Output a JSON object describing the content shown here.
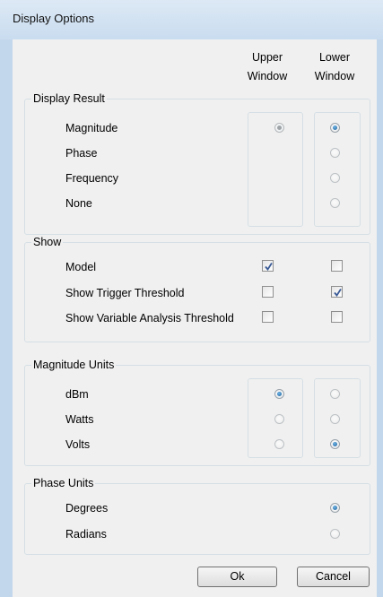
{
  "window": {
    "title": "Display Options"
  },
  "columns": {
    "upper": "Upper\nWindow",
    "lower": "Lower\nWindow"
  },
  "display_result": {
    "title": "Display Result",
    "options": [
      {
        "label": "Magnitude",
        "upper": "selected-disabled",
        "lower": "selected"
      },
      {
        "label": "Phase",
        "upper": "none",
        "lower": "disabled"
      },
      {
        "label": "Frequency",
        "upper": "none",
        "lower": "disabled"
      },
      {
        "label": "None",
        "upper": "none",
        "lower": "disabled"
      }
    ]
  },
  "show": {
    "title": "Show",
    "items": [
      {
        "label": "Model",
        "upper": true,
        "lower": false
      },
      {
        "label": "Show Trigger Threshold",
        "upper": false,
        "lower": true
      },
      {
        "label": "Show Variable Analysis Threshold",
        "upper": false,
        "lower": false
      }
    ]
  },
  "magnitude_units": {
    "title": "Magnitude Units",
    "options": [
      {
        "label": "dBm",
        "upper": "selected",
        "lower": "disabled"
      },
      {
        "label": "Watts",
        "upper": "disabled",
        "lower": "disabled"
      },
      {
        "label": "Volts",
        "upper": "disabled",
        "lower": "selected"
      }
    ]
  },
  "phase_units": {
    "title": "Phase Units",
    "options": [
      {
        "label": "Degrees",
        "lower": "selected"
      },
      {
        "label": "Radians",
        "lower": "disabled"
      }
    ]
  },
  "buttons": {
    "ok": "Ok",
    "cancel": "Cancel"
  },
  "colors": {
    "radio_selected": "#1c5e97",
    "check_mark": "#3a5a96",
    "titlebar": "#dde9f5"
  }
}
